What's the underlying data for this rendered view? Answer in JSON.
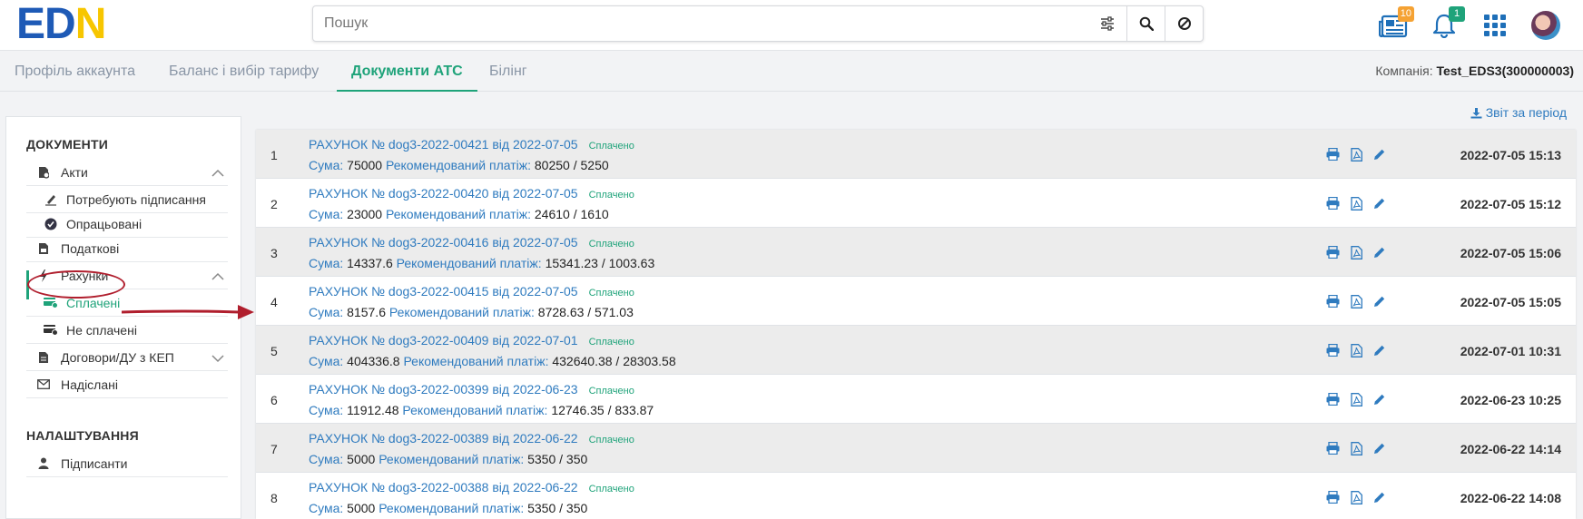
{
  "header": {
    "logo": {
      "e": "E",
      "d": "D",
      "n": "N"
    },
    "search_placeholder": "Пошук",
    "icons": [
      "filter-icon",
      "search-icon",
      "cancel-icon"
    ],
    "news_badge": "10",
    "notifications_badge": "1"
  },
  "tabs": [
    "Профіль аккаунта",
    "Баланс і вибір тарифу",
    "Документи АТС",
    "Білінг"
  ],
  "active_tab": "Документи АТС",
  "company": {
    "label": "Компанія:",
    "value": "Test_EDS3(300000003)"
  },
  "report_link": "Звіт за період",
  "sidebar": {
    "documents_heading": "ДОКУМЕНТИ",
    "acts": "Акти",
    "acts_sub": [
      "Потребують підписання",
      "Опрацьовані"
    ],
    "tax": "Податкові",
    "invoices": "Рахунки",
    "invoices_sub": [
      "Сплачені",
      "Не сплачені"
    ],
    "contracts": "Договори/ДУ з КЕП",
    "sent": "Надіслані",
    "settings_heading": "НАЛАШТУВАННЯ",
    "signers": "Підписанти"
  },
  "labels": {
    "sum": "Сума:",
    "recommended": "Рекомендований платіж:"
  },
  "rows": [
    {
      "num": "1",
      "title": "РАХУНОК № dog3-2022-00421 від 2022-07-05",
      "status": "Сплачено",
      "sum": "75000",
      "rec": "80250 / 5250",
      "date": "2022-07-05 15:13"
    },
    {
      "num": "2",
      "title": "РАХУНОК № dog3-2022-00420 від 2022-07-05",
      "status": "Сплачено",
      "sum": "23000",
      "rec": "24610 / 1610",
      "date": "2022-07-05 15:12"
    },
    {
      "num": "3",
      "title": "РАХУНОК № dog3-2022-00416 від 2022-07-05",
      "status": "Сплачено",
      "sum": "14337.6",
      "rec": "15341.23 / 1003.63",
      "date": "2022-07-05 15:06"
    },
    {
      "num": "4",
      "title": "РАХУНОК № dog3-2022-00415 від 2022-07-05",
      "status": "Сплачено",
      "sum": "8157.6",
      "rec": "8728.63 / 571.03",
      "date": "2022-07-05 15:05"
    },
    {
      "num": "5",
      "title": "РАХУНОК № dog3-2022-00409 від 2022-07-01",
      "status": "Сплачено",
      "sum": "404336.8",
      "rec": "432640.38 / 28303.58",
      "date": "2022-07-01 10:31"
    },
    {
      "num": "6",
      "title": "РАХУНОК № dog3-2022-00399 від 2022-06-23",
      "status": "Сплачено",
      "sum": "11912.48",
      "rec": "12746.35 / 833.87",
      "date": "2022-06-23 10:25"
    },
    {
      "num": "7",
      "title": "РАХУНОК № dog3-2022-00389 від 2022-06-22",
      "status": "Сплачено",
      "sum": "5000",
      "rec": "5350 / 350",
      "date": "2022-06-22 14:14"
    },
    {
      "num": "8",
      "title": "РАХУНОК № dog3-2022-00388 від 2022-06-22",
      "status": "Сплачено",
      "sum": "5000",
      "rec": "5350 / 350",
      "date": "2022-06-22 14:08"
    }
  ],
  "colors": {
    "accent": "#1fa37a",
    "link": "#2f7bbf",
    "brand_blue": "#1e5ab6",
    "brand_yellow": "#f7c600",
    "annotation_red": "#b01e2d"
  }
}
